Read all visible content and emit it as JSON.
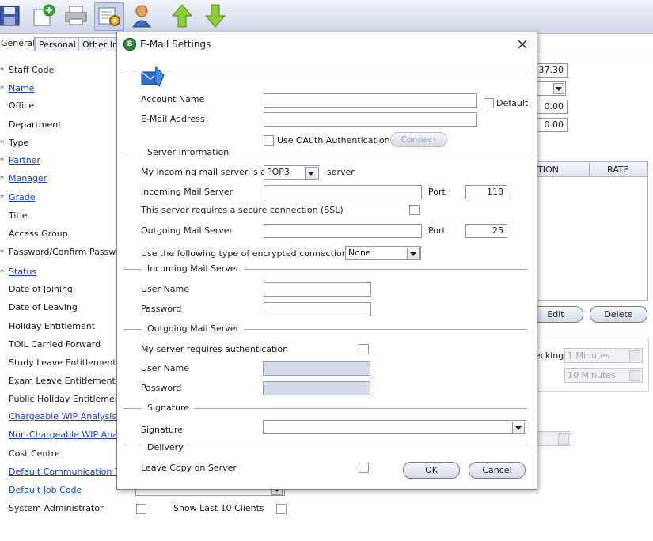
{
  "toolbar": {
    "buttons": [
      {
        "icon": "save-icon"
      },
      {
        "icon": "new-document-icon"
      },
      {
        "icon": "print-icon"
      },
      {
        "icon": "settings-icon"
      },
      {
        "icon": "user-icon"
      },
      {
        "icon": "arrow-up-icon"
      },
      {
        "icon": "arrow-down-icon"
      }
    ]
  },
  "tabs": [
    "General",
    "Personal",
    "Other Inf"
  ],
  "form": {
    "fields": [
      {
        "label": "Staff Code",
        "required": true,
        "link": false
      },
      {
        "label": "Name",
        "required": true,
        "link": true
      },
      {
        "label": "Office",
        "required": false,
        "link": false
      },
      {
        "label": "Department",
        "required": false,
        "link": false
      },
      {
        "label": "Type",
        "required": true,
        "link": false
      },
      {
        "label": "Partner",
        "required": true,
        "link": true
      },
      {
        "label": "Manager",
        "required": true,
        "link": true
      },
      {
        "label": "Grade",
        "required": true,
        "link": true
      },
      {
        "label": "Title",
        "required": false,
        "link": false
      },
      {
        "label": "Access Group",
        "required": false,
        "link": false
      },
      {
        "label": "Password/Confirm Passwo",
        "required": true,
        "link": false
      },
      {
        "label": "Status",
        "required": true,
        "link": true
      },
      {
        "label": "Date of Joining",
        "required": false,
        "link": false
      },
      {
        "label": "Date of Leaving",
        "required": false,
        "link": false
      },
      {
        "label": "Holiday Entitlement",
        "required": false,
        "link": false
      },
      {
        "label": "TOIL Carried Forward",
        "required": false,
        "link": false
      },
      {
        "label": "Study Leave Entitlement",
        "required": false,
        "link": false
      },
      {
        "label": "Exam Leave Entitlement",
        "required": false,
        "link": false
      },
      {
        "label": "Public Holiday Entitlement",
        "required": false,
        "link": false
      },
      {
        "label": "Chargeable WIP Analysis",
        "required": false,
        "link": true
      },
      {
        "label": "Non-Chargeable WIP Analys",
        "required": false,
        "link": true
      },
      {
        "label": "Cost Centre",
        "required": false,
        "link": false
      },
      {
        "label": "Default Communication Typ",
        "required": false,
        "link": true
      },
      {
        "label": "Default Job Code",
        "required": false,
        "link": true
      },
      {
        "label": "System Administrator",
        "required": false,
        "link": false
      }
    ],
    "show_last_clients_label": "Show Last 10 Clients"
  },
  "right_panel": {
    "value1": "37.30",
    "value2": "0.00",
    "value3": "0.00",
    "col_tion": "TION",
    "col_rate": "RATE",
    "edit_label": "Edit",
    "delete_label": "Delete",
    "checking_label": "ecking",
    "interval1": "1 Minutes",
    "interval2": "10 Minutes"
  },
  "dialog": {
    "title": "E-Mail Settings",
    "account_name_label": "Account Name",
    "account_name_value": "",
    "default_label": "Default",
    "email_address_label": "E-Mail Address",
    "email_address_value": "",
    "oauth_label": "Use OAuth Authentication",
    "connect_label": "Connect",
    "server_info_section": "Server Information",
    "incoming_type_label": "My incoming mail server is a",
    "incoming_type_value": "POP3",
    "server_word": "server",
    "incoming_server_label": "Incoming Mail Server",
    "incoming_server_value": "",
    "port_label": "Port",
    "incoming_port": "110",
    "ssl_label": "This server requires a secure connection (SSL)",
    "outgoing_server_label": "Outgoing Mail Server",
    "outgoing_server_value": "",
    "outgoing_port": "25",
    "encryption_label": "Use the following type of encrypted  connection",
    "encryption_value": "None",
    "incoming_section": "Incoming Mail Server",
    "user_name_label": "User Name",
    "password_label": "Password",
    "outgoing_section": "Outgoing Mail Server",
    "requires_auth_label": "My server requires authentication",
    "signature_section": "Signature",
    "signature_label": "Signature",
    "signature_value": "",
    "delivery_section": "Delivery",
    "leave_copy_label": "Leave Copy on Server",
    "ok_label": "OK",
    "cancel_label": "Cancel"
  }
}
